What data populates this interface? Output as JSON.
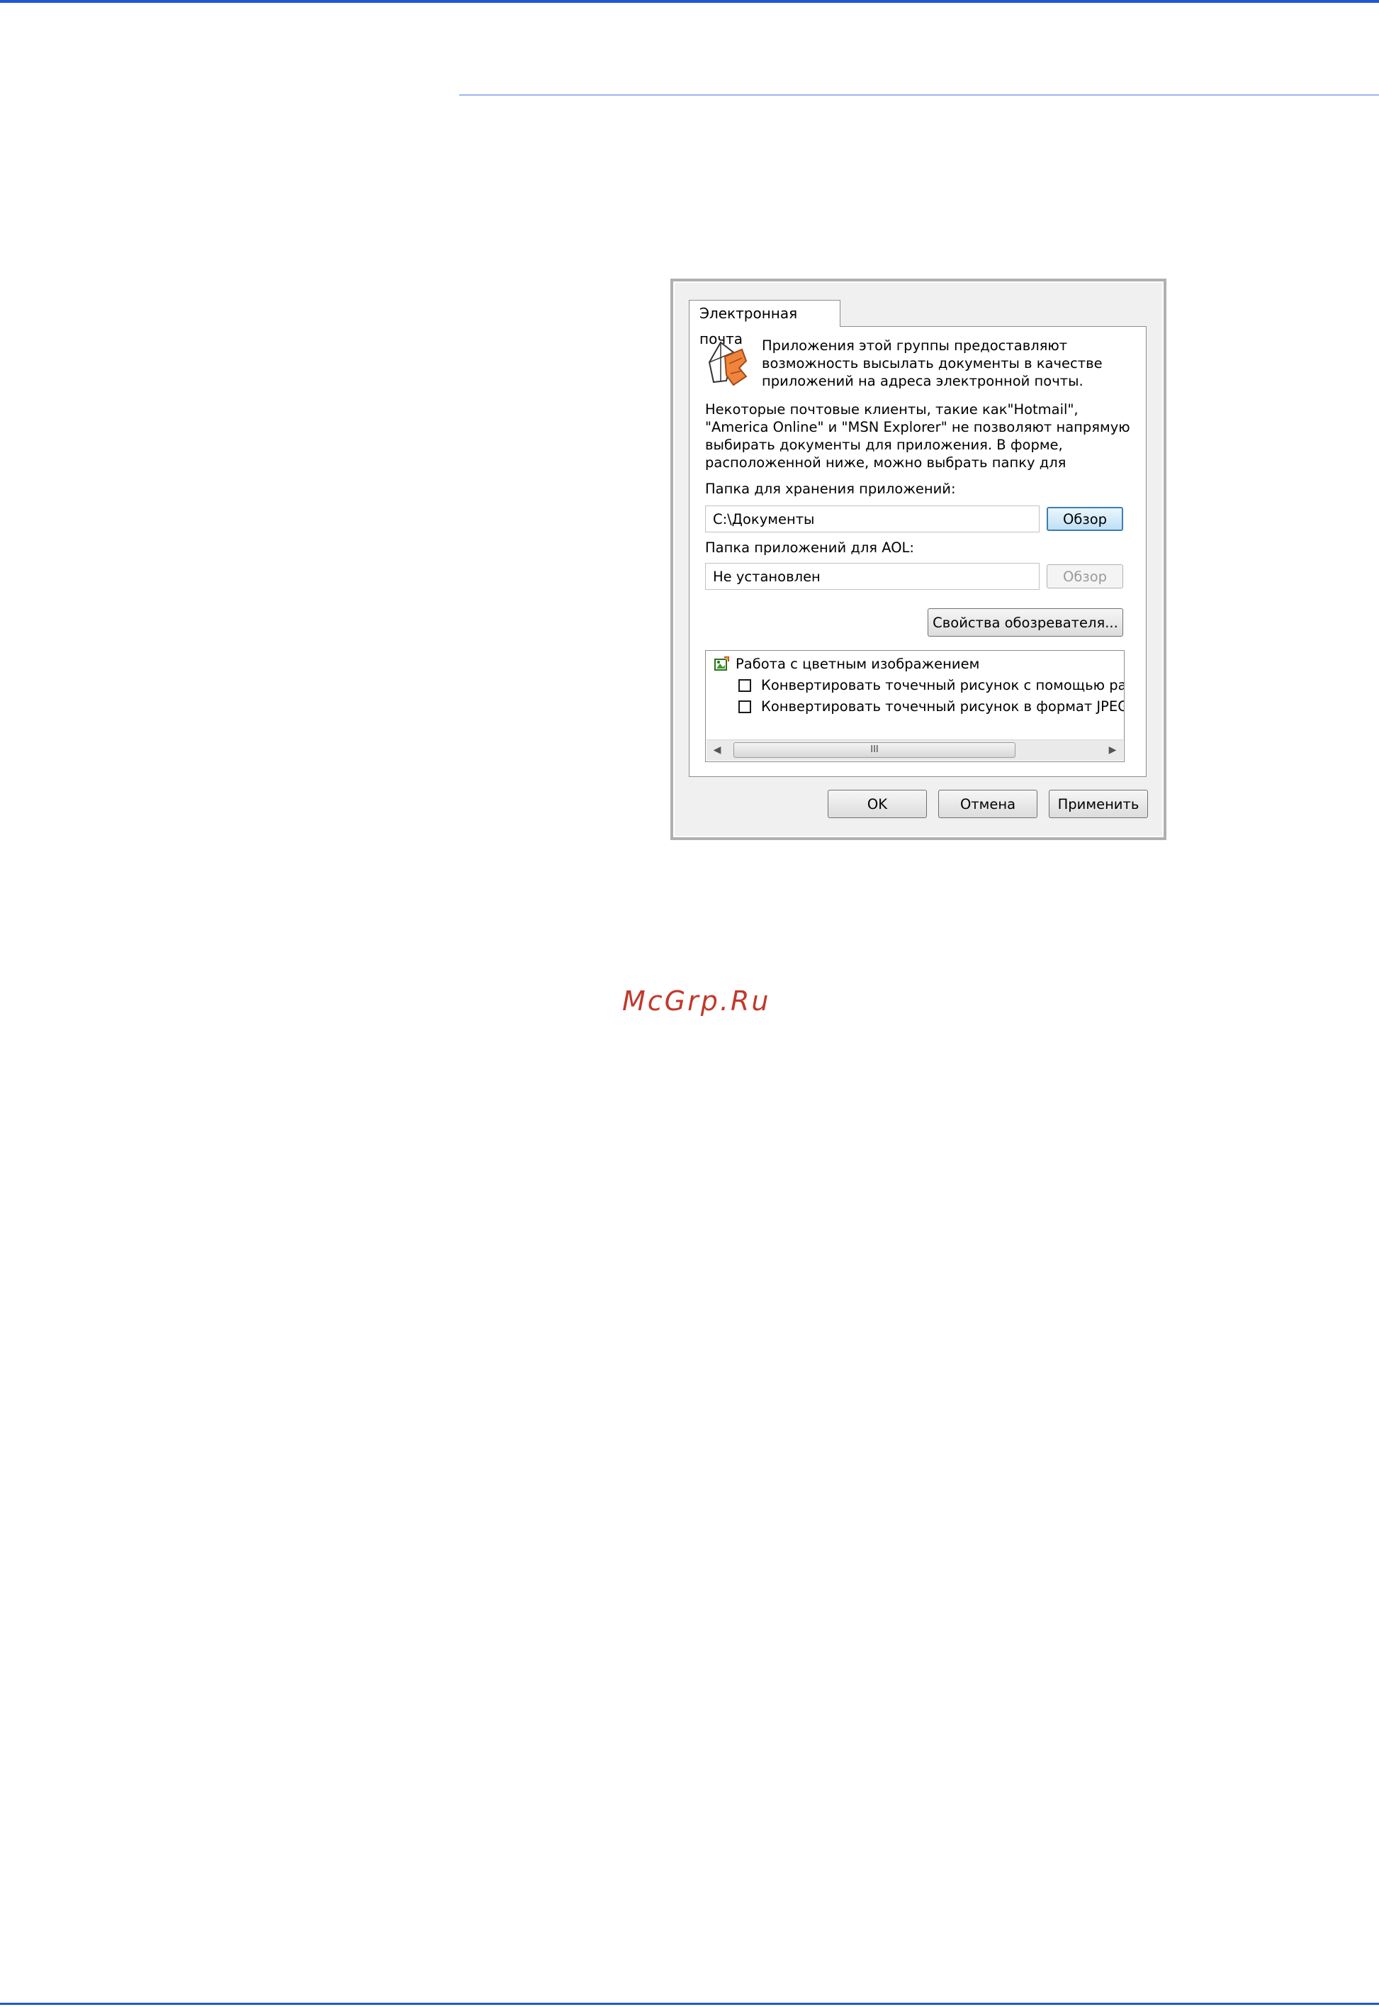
{
  "watermark": "McGrp.Ru",
  "dialog": {
    "tab_label": "Электронная почта",
    "intro_text": "Приложения этой группы предоставляют\nвозможность высылать документы в качестве\nприложений на адреса электронной почты.",
    "note_text": "Некоторые почтовые клиенты, такие как\"Hotmail\",\n\"America Online\" и \"MSN Explorer\" не позволяют напрямую\nвыбирать документы для приложения. В форме,\nрасположенной ниже, можно выбрать папку для",
    "attachments_folder": {
      "label": "Папка для хранения приложений:",
      "value": "C:\\Документы",
      "browse_label": "Обзор"
    },
    "aol_folder": {
      "label": "Папка приложений для AOL:",
      "value": "Не установлен",
      "browse_label": "Обзор"
    },
    "browser_properties_label": "Свойства обозревателя...",
    "options": {
      "group_label": "Работа с цветным изображением",
      "items": [
        {
          "label": "Конвертировать точечный рисунок с помощью раз",
          "checked": false
        },
        {
          "label": "Конвертировать точечный рисунок в формат JPEG",
          "checked": false
        }
      ],
      "scroll_thumb_glyph": "III"
    },
    "buttons": {
      "ok": "OK",
      "cancel": "Отмена",
      "apply": "Применить"
    }
  },
  "colors": {
    "rule_blue": "#1f57d6",
    "header_rule": "#9db4ee",
    "watermark_red": "#c0392b",
    "focus_blue": "#3c7fb1"
  }
}
